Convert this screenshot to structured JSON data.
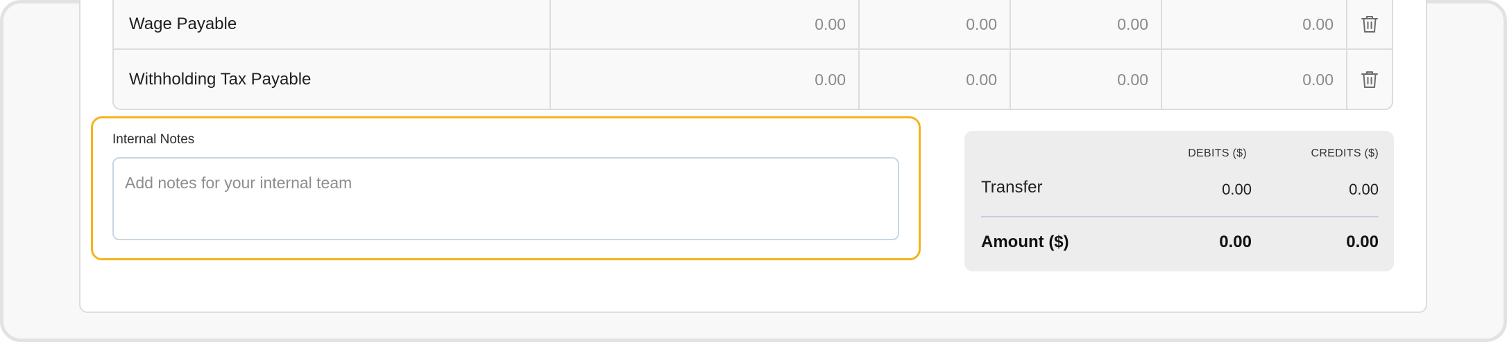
{
  "table": {
    "rows": [
      {
        "account": "Wage Payable",
        "values": [
          "0.00",
          "0.00",
          "0.00",
          "0.00"
        ]
      },
      {
        "account": "Withholding Tax Payable",
        "values": [
          "0.00",
          "0.00",
          "0.00",
          "0.00"
        ]
      }
    ],
    "delete_icon": "trash-icon"
  },
  "notes": {
    "label": "Internal Notes",
    "placeholder": "Add notes for your internal team",
    "value": "",
    "highlight_color": "#f4b41a"
  },
  "totals": {
    "debits_header": "DEBITS ($)",
    "credits_header": "CREDITS ($)",
    "transfer_label": "Transfer",
    "transfer_debits": "0.00",
    "transfer_credits": "0.00",
    "amount_label": "Amount ($)",
    "amount_debits": "0.00",
    "amount_credits": "0.00"
  }
}
